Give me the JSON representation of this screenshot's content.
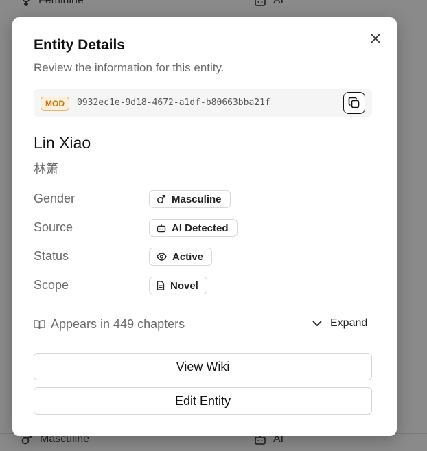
{
  "background": {
    "rows": [
      {
        "gender": "Feminine",
        "source": "AI"
      },
      {
        "gender": "Masculine",
        "source": "AI"
      }
    ]
  },
  "modal": {
    "title": "Entity Details",
    "subtitle": "Review the information for this entity.",
    "id_badge": "MOD",
    "entity_id": "0932ec1e-9d18-4672-a1df-b80663bba21f",
    "name": "Lin Xiao",
    "native_name": "林箫",
    "fields": [
      {
        "label": "Gender",
        "value": "Masculine",
        "icon": "male-icon"
      },
      {
        "label": "Source",
        "value": "AI Detected",
        "icon": "bot-icon"
      },
      {
        "label": "Status",
        "value": "Active",
        "icon": "eye-icon"
      },
      {
        "label": "Scope",
        "value": "Novel",
        "icon": "document-icon"
      }
    ],
    "appearances": "Appears in 449 chapters",
    "expand_label": "Expand",
    "view_wiki_label": "View Wiki",
    "edit_entity_label": "Edit Entity"
  },
  "colors": {
    "badge_border": "#e9b46d",
    "badge_bg": "#fcefd9",
    "badge_text": "#c27712"
  }
}
